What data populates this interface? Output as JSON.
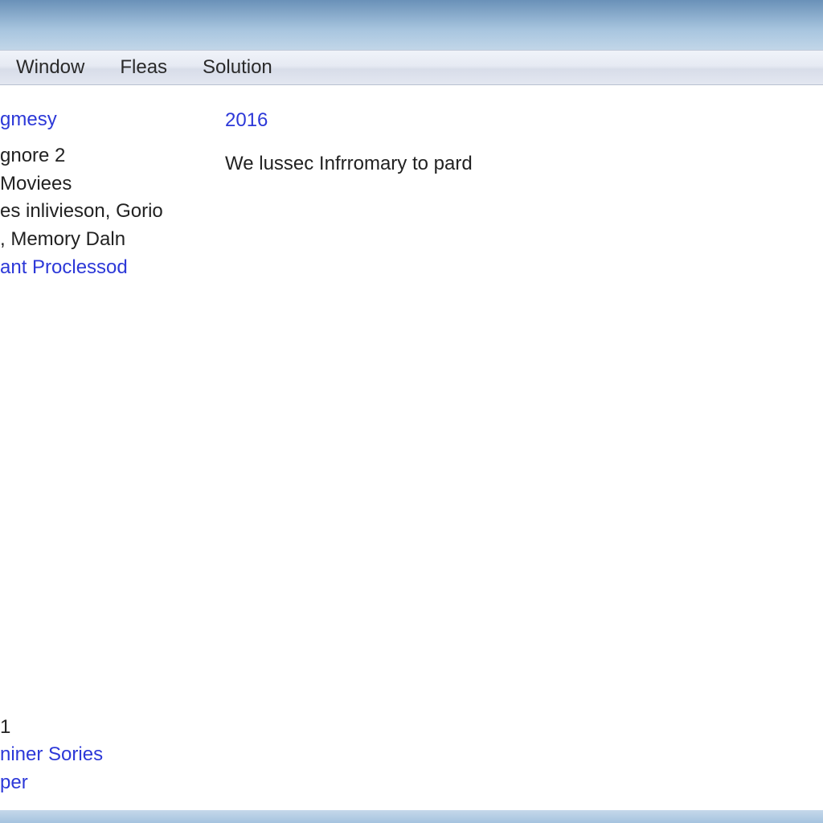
{
  "menu": {
    "items": [
      "Window",
      "Fleas",
      "Solution"
    ]
  },
  "sidebar": {
    "topItems": [
      {
        "text": "gmesy",
        "link": true
      },
      {
        "text": "",
        "link": false
      },
      {
        "text": "gnore 2",
        "link": false
      },
      {
        "text": "Moviees",
        "link": false
      },
      {
        "text": "es inlivieson, Gorio",
        "link": false
      },
      {
        "text": ", Memory Daln",
        "link": false
      },
      {
        "text": "ant Proclessod",
        "link": true
      }
    ],
    "bottomItems": [
      {
        "text": "1",
        "link": false
      },
      {
        "text": "niner Sories",
        "link": true
      },
      {
        "text": "per",
        "link": true
      }
    ]
  },
  "main": {
    "heading": "2016",
    "body": "We lussec Infrromary to pard"
  }
}
